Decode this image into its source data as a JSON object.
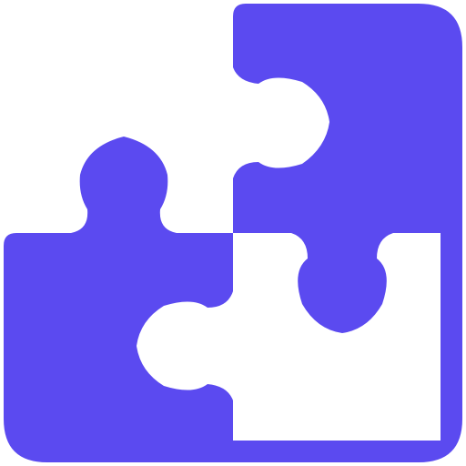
{
  "icon": {
    "name": "puzzle-icon",
    "color": "#5B4AF0",
    "background": "#FFFFFF"
  }
}
